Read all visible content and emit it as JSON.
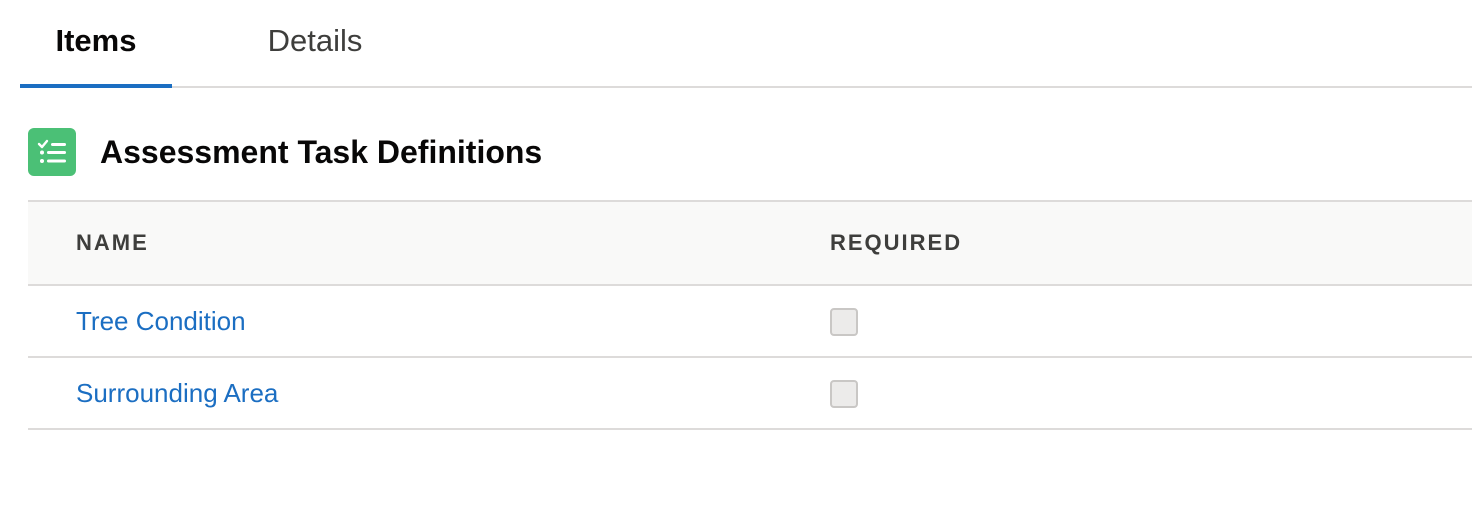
{
  "tabs": [
    {
      "label": "Items",
      "active": true
    },
    {
      "label": "Details",
      "active": false
    }
  ],
  "card": {
    "icon": "task-list-icon",
    "icon_color": "#4bc076",
    "title": "Assessment Task Definitions"
  },
  "table": {
    "columns": [
      "NAME",
      "REQUIRED"
    ],
    "rows": [
      {
        "name": "Tree Condition",
        "required": false
      },
      {
        "name": "Surrounding Area",
        "required": false
      }
    ]
  },
  "colors": {
    "link": "#1b6ec2",
    "active_tab_underline": "#1b6ec2",
    "header_bg": "#f9f9f8"
  }
}
